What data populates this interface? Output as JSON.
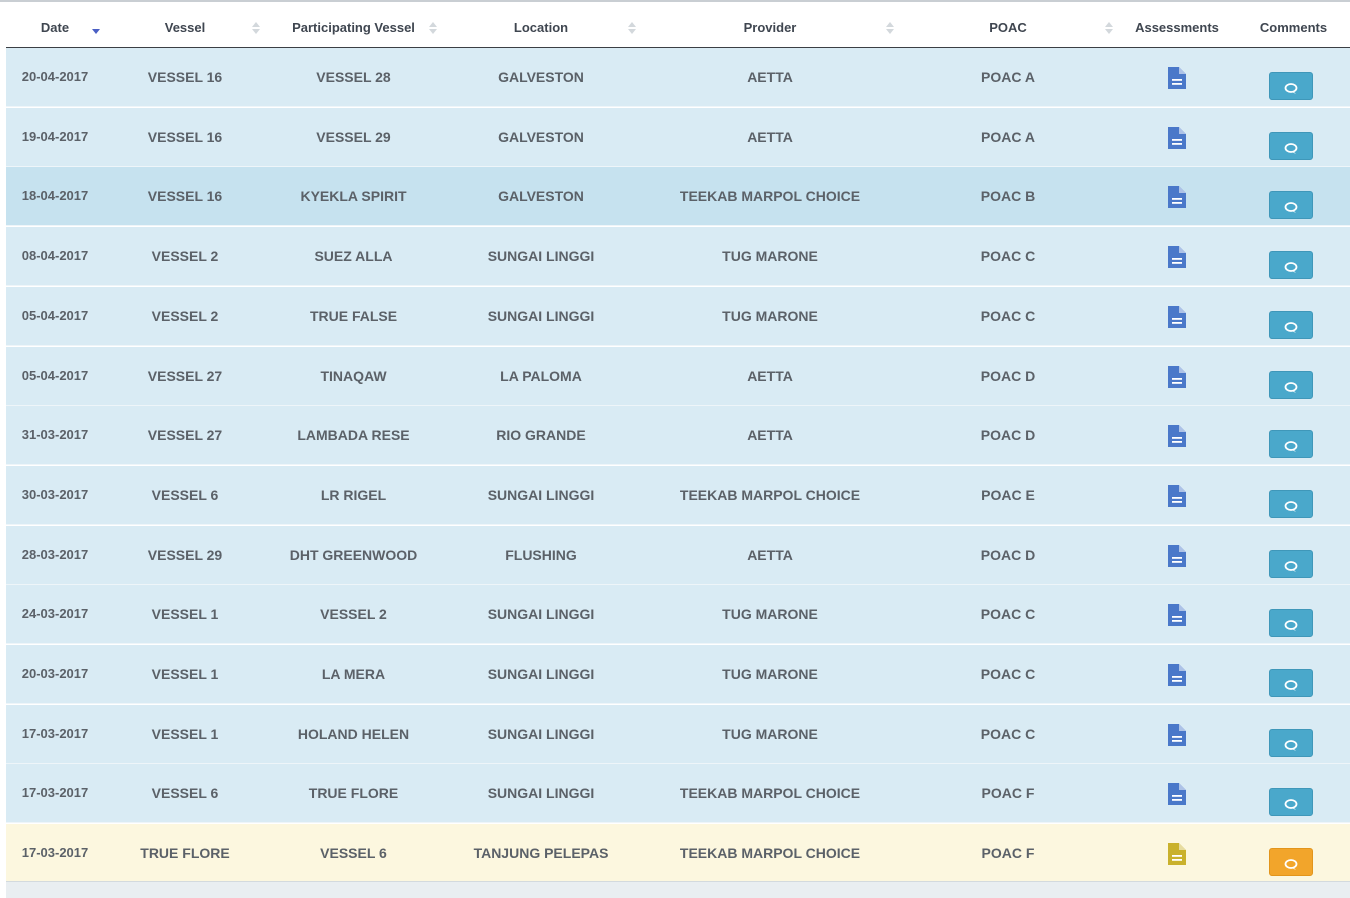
{
  "table": {
    "columns": {
      "date": "Date",
      "vessel": "Vessel",
      "participating": "Participating Vessel",
      "location": "Location",
      "provider": "Provider",
      "poac": "POAC",
      "assessments": "Assessments",
      "comments": "Comments"
    },
    "sort": {
      "column": "date",
      "direction": "descending"
    },
    "rows": [
      {
        "date": "20-04-2017",
        "vessel": "VESSEL 16",
        "participating": "VESSEL 28",
        "location": "GALVESTON",
        "provider": "AETTA",
        "poac": "POAC A",
        "state": "normal"
      },
      {
        "date": "19-04-2017",
        "vessel": "VESSEL 16",
        "participating": "VESSEL 29",
        "location": "GALVESTON",
        "provider": "AETTA",
        "poac": "POAC A",
        "state": "normal"
      },
      {
        "date": "18-04-2017",
        "vessel": "VESSEL 16",
        "participating": "KYEKLA SPIRIT",
        "location": "GALVESTON",
        "provider": "TEEKAB MARPOL CHOICE",
        "poac": "POAC B",
        "state": "highlighted"
      },
      {
        "date": "08-04-2017",
        "vessel": "VESSEL 2",
        "participating": "SUEZ ALLA",
        "location": "SUNGAI LINGGI",
        "provider": "TUG MARONE",
        "poac": "POAC C",
        "state": "normal"
      },
      {
        "date": "05-04-2017",
        "vessel": "VESSEL 2",
        "participating": "TRUE FALSE",
        "location": "SUNGAI LINGGI",
        "provider": "TUG MARONE",
        "poac": "POAC C",
        "state": "normal"
      },
      {
        "date": "05-04-2017",
        "vessel": "VESSEL 27",
        "participating": "TINAQAW",
        "location": "LA PALOMA",
        "provider": "AETTA",
        "poac": "POAC D",
        "state": "normal"
      },
      {
        "date": "31-03-2017",
        "vessel": "VESSEL 27",
        "participating": "LAMBADA RESE",
        "location": "RIO GRANDE",
        "provider": "AETTA",
        "poac": "POAC D",
        "state": "normal"
      },
      {
        "date": "30-03-2017",
        "vessel": "VESSEL 6",
        "participating": "LR RIGEL",
        "location": "SUNGAI LINGGI",
        "provider": "TEEKAB MARPOL CHOICE",
        "poac": "POAC E",
        "state": "normal"
      },
      {
        "date": "28-03-2017",
        "vessel": "VESSEL 29",
        "participating": "DHT GREENWOOD",
        "location": "FLUSHING",
        "provider": "AETTA",
        "poac": "POAC D",
        "state": "normal"
      },
      {
        "date": "24-03-2017",
        "vessel": "VESSEL 1",
        "participating": "VESSEL 2",
        "location": "SUNGAI LINGGI",
        "provider": "TUG MARONE",
        "poac": "POAC C",
        "state": "normal"
      },
      {
        "date": "20-03-2017",
        "vessel": "VESSEL 1",
        "participating": "LA MERA",
        "location": "SUNGAI LINGGI",
        "provider": "TUG MARONE",
        "poac": "POAC C",
        "state": "normal"
      },
      {
        "date": "17-03-2017",
        "vessel": "VESSEL 1",
        "participating": "HOLAND HELEN",
        "location": "SUNGAI LINGGI",
        "provider": "TUG MARONE",
        "poac": "POAC C",
        "state": "normal"
      },
      {
        "date": "17-03-2017",
        "vessel": "VESSEL 6",
        "participating": "TRUE FLORE",
        "location": "SUNGAI LINGGI",
        "provider": "TEEKAB MARPOL CHOICE",
        "poac": "POAC F",
        "state": "normal"
      },
      {
        "date": "17-03-2017",
        "vessel": "TRUE FLORE",
        "participating": "VESSEL 6",
        "location": "TANJUNG PELEPAS",
        "provider": "TEEKAB MARPOL CHOICE",
        "poac": "POAC F",
        "state": "warning"
      }
    ]
  },
  "icons": {
    "assessment": "document-icon",
    "comment": "chat-bubble-icon",
    "sort_active": "sort-desc-icon",
    "sort_inactive": "sort-both-icon"
  },
  "colors": {
    "row_normal": "#d9ebf4",
    "row_highlight": "#c6e2ef",
    "row_warning": "#fcf7df",
    "doc_icon": "#4a78c9",
    "doc_icon_warning": "#c9b12c",
    "comment_button": "#4aa8cb",
    "comment_button_warning": "#f2a52b"
  }
}
